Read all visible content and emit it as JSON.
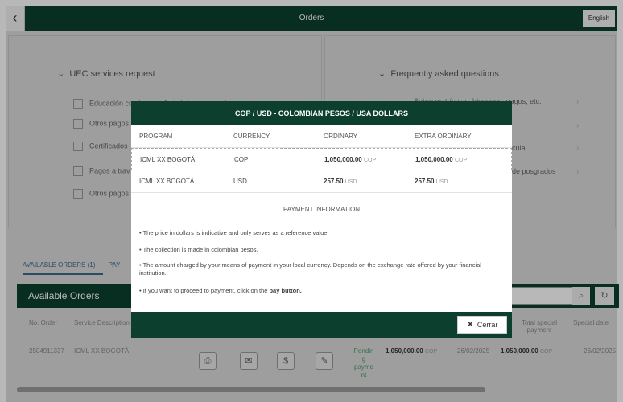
{
  "header": {
    "back_icon": "chevron-left-icon",
    "title": "Orders",
    "language": "English"
  },
  "services": {
    "heading": "UEC services request",
    "items": [
      {
        "label": "Educación continua y oferta intersemestral",
        "icon": "document-icon"
      },
      {
        "label": "Otros pagos",
        "icon": "document-icon"
      },
      {
        "label": "Certificados",
        "icon": "certificate-icon"
      },
      {
        "label": "Pagos a trav",
        "icon": "calendar-icon"
      },
      {
        "label": "Otros pagos",
        "icon": "image-icon"
      }
    ]
  },
  "faq": {
    "heading": "Frequently asked questions",
    "items": [
      {
        "label": "Sobre matrículas, bloqueos, pagos, etc."
      },
      {
        "label": "cula."
      },
      {
        "label": "de posgrados"
      }
    ]
  },
  "tabs": {
    "available": "AVAILABLE ORDERS (1)",
    "partial": "PAY"
  },
  "orders": {
    "title": "Available Orders",
    "columns": {
      "no_order": "No. Order",
      "service": "Service Description",
      "total_special": "Total special payment",
      "special_date": "Special date"
    },
    "row": {
      "no_order": "2504911337",
      "service": "ICML XX BOGOTÁ",
      "status": "Pendin g payme nt",
      "amount": "1,050,000.00",
      "amount_cur": "COP",
      "date": "26/02/2025",
      "special_amount": "1,050,000.00",
      "special_cur": "COP",
      "special_date": "26/02/2025"
    }
  },
  "modal": {
    "title": "COP / USD - COLOMBIAN PESOS / USA DOLLARS",
    "columns": {
      "program": "PROGRAM",
      "currency": "CURRENCY",
      "ordinary": "ORDINARY",
      "extra": "EXTRA ORDINARY"
    },
    "rows": [
      {
        "program": "ICML XX BOGOTÁ",
        "currency": "COP",
        "ordinary": "1,050,000.00",
        "ordinary_cur": "COP",
        "extra": "1,050,000.00",
        "extra_cur": "COP"
      },
      {
        "program": "ICML XX BOGOTÁ",
        "currency": "USD",
        "ordinary": "257.50",
        "ordinary_cur": "USD",
        "extra": "257.50",
        "extra_cur": "USD"
      }
    ],
    "payment_title": "PAYMENT INFORMATION",
    "notes": [
      "• The price in dollars is indicative and only serves as a reference value.",
      "• The collection is made in colombian pesos.",
      "• The amount charged by your means of payment in your local currency. Depends on the exchange rate offered by your financial institution."
    ],
    "last_note_prefix": "• If you want to proceed to payment. click on the ",
    "last_note_bold": "pay button.",
    "close_label": "Cerrar"
  }
}
